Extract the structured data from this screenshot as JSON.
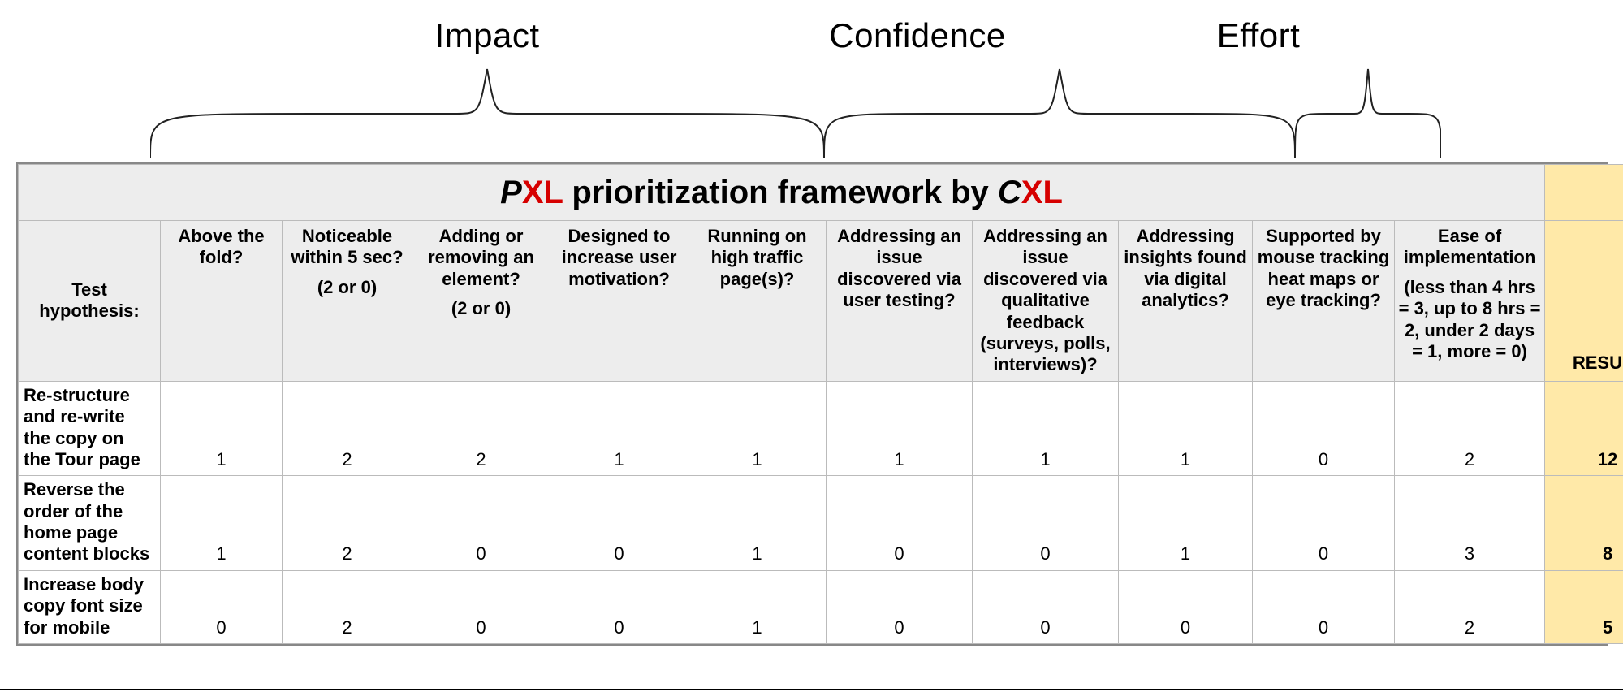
{
  "groups": {
    "impact": {
      "label": "Impact"
    },
    "confidence": {
      "label": "Confidence"
    },
    "effort": {
      "label": "Effort"
    }
  },
  "title": {
    "p": "P",
    "xl1": "XL",
    "mid": " prioritization framework by ",
    "c": "C",
    "xl2": "XL"
  },
  "headers": {
    "test_hypothesis": "Test hypothesis:",
    "above_fold": "Above the fold?",
    "noticeable": "Noticeable within 5 sec?",
    "noticeable_sub": "(2 or 0)",
    "add_remove": "Adding or removing an element?",
    "add_remove_sub": "(2 or 0)",
    "motivation": "Designed to increase user motivation?",
    "high_traffic": "Running on high traffic page(s)?",
    "user_testing": "Addressing an issue discovered via user testing?",
    "qualitative": "Addressing an issue discovered via qualitative feedback (surveys, polls, interviews)?",
    "analytics": "Addressing insights found via digital analytics?",
    "mouse_tracking": "Supported by mouse tracking heat maps or eye tracking?",
    "ease": "Ease of implementation",
    "ease_sub": "(less than 4 hrs = 3, up to 8 hrs = 2, under 2 days = 1, more = 0)",
    "result": "RESULT"
  },
  "chart_data": {
    "type": "table",
    "title": "PXL prioritization framework by CXL",
    "columns": [
      "Test hypothesis",
      "Above the fold?",
      "Noticeable within 5 sec? (2 or 0)",
      "Adding or removing an element? (2 or 0)",
      "Designed to increase user motivation?",
      "Running on high traffic page(s)?",
      "Addressing an issue discovered via user testing?",
      "Addressing an issue discovered via qualitative feedback (surveys, polls, interviews)?",
      "Addressing insights found via digital analytics?",
      "Supported by mouse tracking heat maps or eye tracking?",
      "Ease of implementation (less than 4 hrs = 3, up to 8 hrs = 2, under 2 days = 1, more = 0)",
      "RESULT"
    ],
    "column_groups": {
      "Impact": [
        "Above the fold?",
        "Noticeable within 5 sec? (2 or 0)",
        "Adding or removing an element? (2 or 0)",
        "Designed to increase user motivation?",
        "Running on high traffic page(s)?"
      ],
      "Confidence": [
        "Addressing an issue discovered via user testing?",
        "Addressing an issue discovered via qualitative feedback (surveys, polls, interviews)?",
        "Addressing insights found via digital analytics?",
        "Supported by mouse tracking heat maps or eye tracking?"
      ],
      "Effort": [
        "Ease of implementation (less than 4 hrs = 3, up to 8 hrs = 2, under 2 days = 1, more = 0)"
      ]
    },
    "rows": [
      {
        "hypothesis": "Re-structure and re-write the copy on the Tour page",
        "values": [
          1,
          2,
          2,
          1,
          1,
          1,
          1,
          1,
          0,
          2
        ],
        "result": 12
      },
      {
        "hypothesis": "Reverse the order of the home page content blocks",
        "values": [
          1,
          2,
          0,
          0,
          1,
          0,
          0,
          1,
          0,
          3
        ],
        "result": 8
      },
      {
        "hypothesis": "Increase body copy font size for mobile",
        "values": [
          0,
          2,
          0,
          0,
          1,
          0,
          0,
          0,
          0,
          2
        ],
        "result": 5
      }
    ]
  }
}
